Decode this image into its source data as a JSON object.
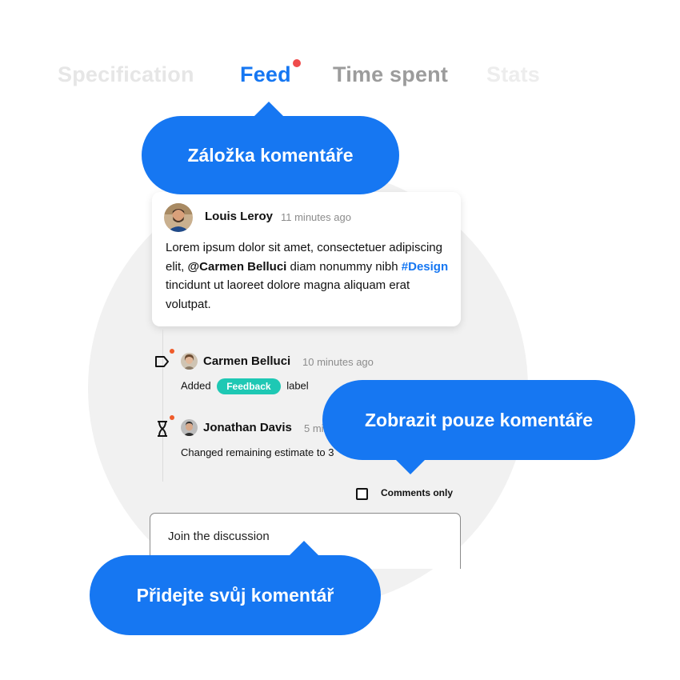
{
  "tabs": [
    {
      "label": "Specification"
    },
    {
      "label": "Feed",
      "active": true,
      "has_notification": true
    },
    {
      "label": "Time spent"
    },
    {
      "label": "Stats"
    }
  ],
  "callouts": {
    "comments_tab": "Záložka komentáře",
    "comments_only": "Zobrazit pouze komentáře",
    "add_comment": "Přidejte svůj komentář"
  },
  "comment": {
    "author": "Louis Leroy",
    "time": "11 minutes ago",
    "text_1": "Lorem ipsum dolor sit amet, consectetuer adipiscing elit, ",
    "mention": "@Carmen Belluci",
    "text_2": " diam nonummy nibh ",
    "hashtag": "#Design",
    "text_3": " tincidunt ut laoreet dolore magna aliquam erat volutpat."
  },
  "events": [
    {
      "icon": "label-icon",
      "author": "Carmen Belluci",
      "time": "10 minutes ago",
      "text_before": "Added",
      "label": "Feedback",
      "text_after": "label"
    },
    {
      "icon": "hourglass-icon",
      "author": "Jonathan Davis",
      "time": "5 min",
      "text": "Changed remaining estimate to 3"
    }
  ],
  "filter": {
    "comments_only_label": "Comments only",
    "checked": false
  },
  "discussion": {
    "placeholder": "Join the discussion"
  },
  "colors": {
    "accent": "#1677f2",
    "notification": "#ef4b4b",
    "label_feedback": "#1ec8b4",
    "background_circle": "#f1f1f1"
  }
}
